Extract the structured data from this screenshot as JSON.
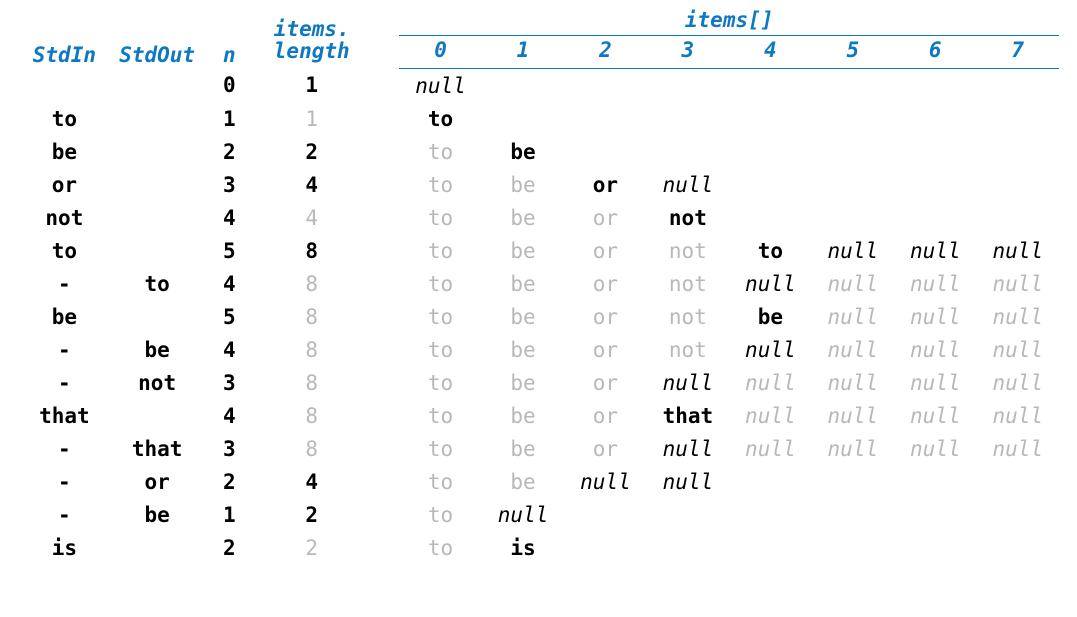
{
  "headers": {
    "stdin": "StdIn",
    "stdout": "StdOut",
    "n": "n",
    "items_length_line1": "items.",
    "items_length_line2": "length",
    "items_array": "items[]",
    "indices": [
      "0",
      "1",
      "2",
      "3",
      "4",
      "5",
      "6",
      "7"
    ]
  },
  "rows": [
    {
      "stdin": "",
      "stdout": "",
      "n": "0",
      "length": {
        "t": "1",
        "s": "strong"
      },
      "items": [
        {
          "t": "null",
          "s": "null-strong"
        }
      ]
    },
    {
      "stdin": "to",
      "stdout": "",
      "n": "1",
      "length": {
        "t": "1",
        "s": "dim"
      },
      "items": [
        {
          "t": "to",
          "s": "strong"
        }
      ]
    },
    {
      "stdin": "be",
      "stdout": "",
      "n": "2",
      "length": {
        "t": "2",
        "s": "strong"
      },
      "items": [
        {
          "t": "to",
          "s": "dim"
        },
        {
          "t": "be",
          "s": "strong"
        }
      ]
    },
    {
      "stdin": "or",
      "stdout": "",
      "n": "3",
      "length": {
        "t": "4",
        "s": "strong"
      },
      "items": [
        {
          "t": "to",
          "s": "dim"
        },
        {
          "t": "be",
          "s": "dim"
        },
        {
          "t": "or",
          "s": "strong"
        },
        {
          "t": "null",
          "s": "null-strong"
        }
      ]
    },
    {
      "stdin": "not",
      "stdout": "",
      "n": "4",
      "length": {
        "t": "4",
        "s": "dim"
      },
      "items": [
        {
          "t": "to",
          "s": "dim"
        },
        {
          "t": "be",
          "s": "dim"
        },
        {
          "t": "or",
          "s": "dim"
        },
        {
          "t": "not",
          "s": "strong"
        }
      ]
    },
    {
      "stdin": "to",
      "stdout": "",
      "n": "5",
      "length": {
        "t": "8",
        "s": "strong"
      },
      "items": [
        {
          "t": "to",
          "s": "dim"
        },
        {
          "t": "be",
          "s": "dim"
        },
        {
          "t": "or",
          "s": "dim"
        },
        {
          "t": "not",
          "s": "dim"
        },
        {
          "t": "to",
          "s": "strong"
        },
        {
          "t": "null",
          "s": "null-strong"
        },
        {
          "t": "null",
          "s": "null-strong"
        },
        {
          "t": "null",
          "s": "null-strong"
        }
      ]
    },
    {
      "stdin": "-",
      "stdout": "to",
      "n": "4",
      "length": {
        "t": "8",
        "s": "dim"
      },
      "items": [
        {
          "t": "to",
          "s": "dim"
        },
        {
          "t": "be",
          "s": "dim"
        },
        {
          "t": "or",
          "s": "dim"
        },
        {
          "t": "not",
          "s": "dim"
        },
        {
          "t": "null",
          "s": "null-strong"
        },
        {
          "t": "null",
          "s": "null-dim"
        },
        {
          "t": "null",
          "s": "null-dim"
        },
        {
          "t": "null",
          "s": "null-dim"
        }
      ]
    },
    {
      "stdin": "be",
      "stdout": "",
      "n": "5",
      "length": {
        "t": "8",
        "s": "dim"
      },
      "items": [
        {
          "t": "to",
          "s": "dim"
        },
        {
          "t": "be",
          "s": "dim"
        },
        {
          "t": "or",
          "s": "dim"
        },
        {
          "t": "not",
          "s": "dim"
        },
        {
          "t": "be",
          "s": "strong"
        },
        {
          "t": "null",
          "s": "null-dim"
        },
        {
          "t": "null",
          "s": "null-dim"
        },
        {
          "t": "null",
          "s": "null-dim"
        }
      ]
    },
    {
      "stdin": "-",
      "stdout": "be",
      "n": "4",
      "length": {
        "t": "8",
        "s": "dim"
      },
      "items": [
        {
          "t": "to",
          "s": "dim"
        },
        {
          "t": "be",
          "s": "dim"
        },
        {
          "t": "or",
          "s": "dim"
        },
        {
          "t": "not",
          "s": "dim"
        },
        {
          "t": "null",
          "s": "null-strong"
        },
        {
          "t": "null",
          "s": "null-dim"
        },
        {
          "t": "null",
          "s": "null-dim"
        },
        {
          "t": "null",
          "s": "null-dim"
        }
      ]
    },
    {
      "stdin": "-",
      "stdout": "not",
      "n": "3",
      "length": {
        "t": "8",
        "s": "dim"
      },
      "items": [
        {
          "t": "to",
          "s": "dim"
        },
        {
          "t": "be",
          "s": "dim"
        },
        {
          "t": "or",
          "s": "dim"
        },
        {
          "t": "null",
          "s": "null-strong"
        },
        {
          "t": "null",
          "s": "null-dim"
        },
        {
          "t": "null",
          "s": "null-dim"
        },
        {
          "t": "null",
          "s": "null-dim"
        },
        {
          "t": "null",
          "s": "null-dim"
        }
      ]
    },
    {
      "stdin": "that",
      "stdout": "",
      "n": "4",
      "length": {
        "t": "8",
        "s": "dim"
      },
      "items": [
        {
          "t": "to",
          "s": "dim"
        },
        {
          "t": "be",
          "s": "dim"
        },
        {
          "t": "or",
          "s": "dim"
        },
        {
          "t": "that",
          "s": "strong"
        },
        {
          "t": "null",
          "s": "null-dim"
        },
        {
          "t": "null",
          "s": "null-dim"
        },
        {
          "t": "null",
          "s": "null-dim"
        },
        {
          "t": "null",
          "s": "null-dim"
        }
      ]
    },
    {
      "stdin": "-",
      "stdout": "that",
      "n": "3",
      "length": {
        "t": "8",
        "s": "dim"
      },
      "items": [
        {
          "t": "to",
          "s": "dim"
        },
        {
          "t": "be",
          "s": "dim"
        },
        {
          "t": "or",
          "s": "dim"
        },
        {
          "t": "null",
          "s": "null-strong"
        },
        {
          "t": "null",
          "s": "null-dim"
        },
        {
          "t": "null",
          "s": "null-dim"
        },
        {
          "t": "null",
          "s": "null-dim"
        },
        {
          "t": "null",
          "s": "null-dim"
        }
      ]
    },
    {
      "stdin": "-",
      "stdout": "or",
      "n": "2",
      "length": {
        "t": "4",
        "s": "strong"
      },
      "items": [
        {
          "t": "to",
          "s": "dim"
        },
        {
          "t": "be",
          "s": "dim"
        },
        {
          "t": "null",
          "s": "null-strong"
        },
        {
          "t": "null",
          "s": "null-strong"
        }
      ]
    },
    {
      "stdin": "-",
      "stdout": "be",
      "n": "1",
      "length": {
        "t": "2",
        "s": "strong"
      },
      "items": [
        {
          "t": "to",
          "s": "dim"
        },
        {
          "t": "null",
          "s": "null-strong"
        }
      ]
    },
    {
      "stdin": "is",
      "stdout": "",
      "n": "2",
      "length": {
        "t": "2",
        "s": "dim"
      },
      "items": [
        {
          "t": "to",
          "s": "dim"
        },
        {
          "t": "is",
          "s": "strong"
        }
      ]
    }
  ]
}
